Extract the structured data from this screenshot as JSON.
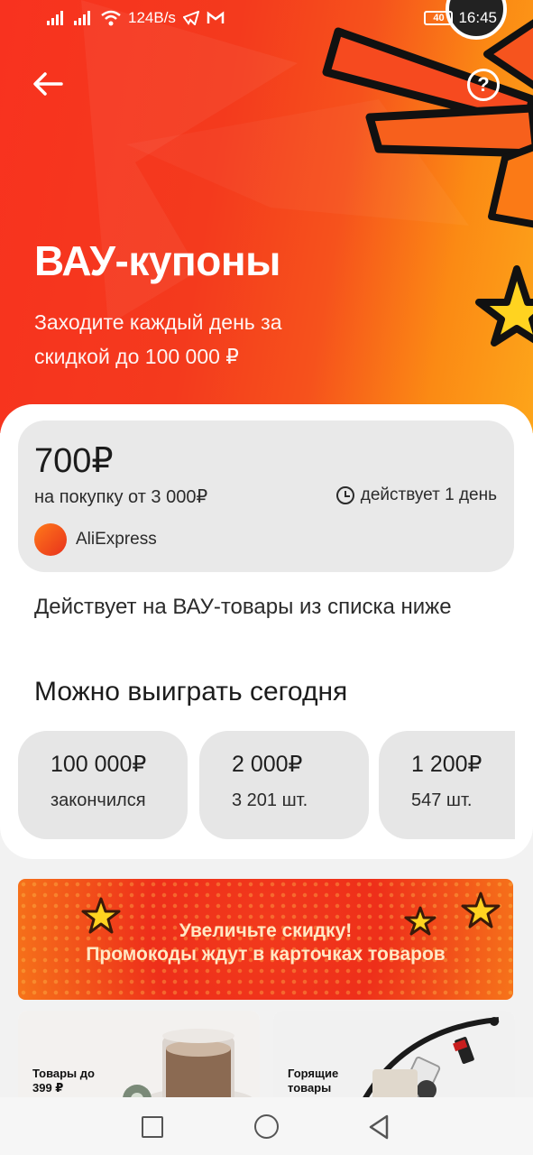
{
  "status_bar": {
    "net_speed": "124B/s",
    "battery": "40",
    "time": "16:45"
  },
  "header": {
    "title": "ВАУ-купоны",
    "subtitle": "Заходите каждый день за скидкой до 100 000 ₽"
  },
  "coupon": {
    "value": "700₽",
    "condition": "на покупку от 3 000₽",
    "validity": "действует 1 день",
    "seller": "AliExpress",
    "seller_logo_text": "AliExpress"
  },
  "applies_note": "Действует на ВАУ-товары из списка ниже",
  "win_section": {
    "title": "Можно выиграть сегодня",
    "prizes": [
      {
        "amount": "100 000₽",
        "status": "закончился"
      },
      {
        "amount": "2 000₽",
        "status": "3 201 шт."
      },
      {
        "amount": "1 200₽",
        "status": "547 шт."
      }
    ]
  },
  "promo_banner": {
    "line1": "Увеличьте скидку!",
    "line2": "Промокоды ждут в карточках товаров"
  },
  "categories": [
    {
      "label": "Товары до 399 ₽"
    },
    {
      "label": "Горящие товары"
    }
  ],
  "colors": {
    "accent_red": "#f43a1d",
    "accent_orange": "#fb8a14",
    "star_yellow": "#ffd320"
  }
}
